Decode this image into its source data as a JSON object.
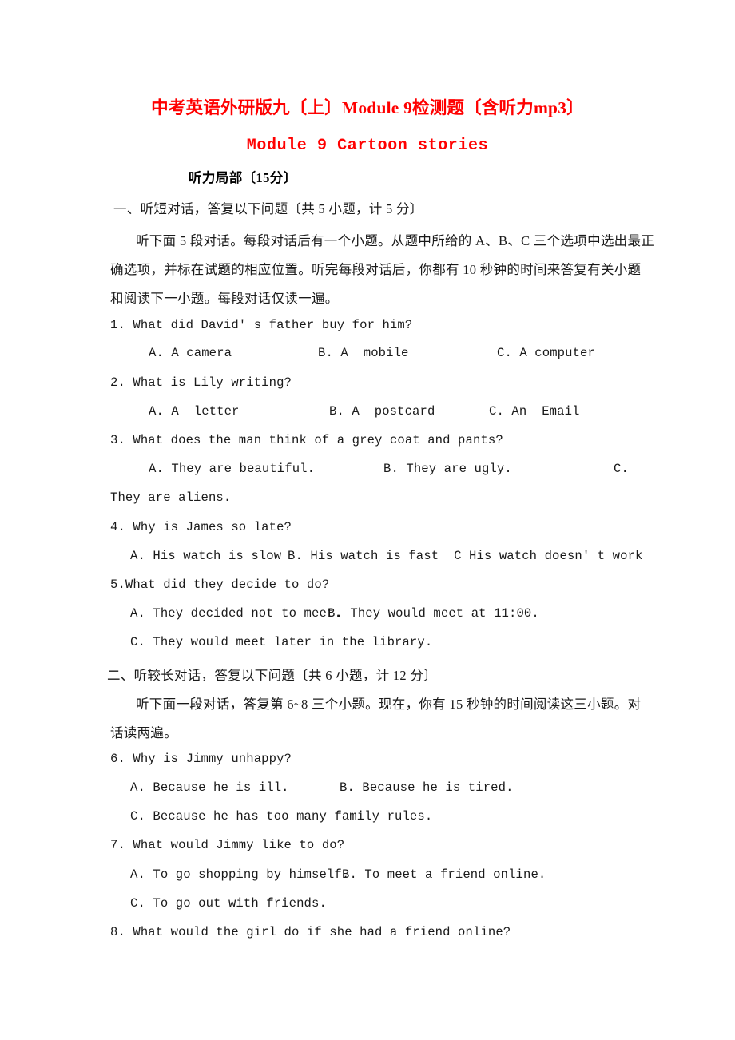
{
  "document": {
    "title": "中考英语外研版九〔上〕Module 9检测题〔含听力mp3〕",
    "subtitle": "Module 9  Cartoon stories",
    "section_heading": "听力局部〔15分〕",
    "title_color": "#ff0000"
  },
  "part_one": {
    "heading": "一、听短对话，答复以下问题〔共 5 小题，计 5 分〕",
    "instruction_lines": [
      "听下面 5 段对话。每段对话后有一个小题。从题中所给的 A、B、C 三个选项中选出最正",
      "确选项，并标在试题的相应位置。听完每段对话后，你都有 10 秒钟的时间来答复有关小题",
      "和阅读下一小题。每段对话仅读一遍。"
    ],
    "questions": [
      {
        "number": "1.",
        "stem": "1. What did David' s father buy for him?",
        "option_a": "A. A camera",
        "option_b": "B. A  mobile",
        "option_c": "C. A computer"
      },
      {
        "number": "2.",
        "stem": "2. What is Lily writing?",
        "option_a": "A. A  letter",
        "option_b": "B. A  postcard",
        "option_c": "C. An  Email"
      },
      {
        "number": "3.",
        "stem": "3. What does the man think of a grey coat and pants?",
        "option_a": "A. They are beautiful.",
        "option_b": "B. They are ugly.",
        "option_c": "C.",
        "option_c_wrap": "They are aliens."
      },
      {
        "number": "4.",
        "stem": "4. Why is James so late?",
        "option_a": "A. His watch is slow",
        "option_bc": "B. His watch is fast  C His watch doesn' t work"
      },
      {
        "number": "5.",
        "stem": "5.What did they decide to do?",
        "option_a": "A. They decided not to meet.",
        "option_b": "B. They would meet at 11:00.",
        "option_c": "C. They would meet later in the library."
      }
    ]
  },
  "part_two": {
    "heading": "二、听较长对话，答复以下问题〔共 6 小题，计 12 分〕",
    "instruction_lines": [
      "听下面一段对话，答复第 6~8 三个小题。现在，你有 15 秒钟的时间阅读这三小题。对",
      "话读两遍。"
    ],
    "questions": [
      {
        "number": "6.",
        "stem": "6. Why is Jimmy unhappy?",
        "option_a": "A. Because he is ill.",
        "option_b": "B. Because he is tired.",
        "option_c": "C. Because he has too many family rules."
      },
      {
        "number": "7.",
        "stem": "7. What would Jimmy like to do?",
        "option_a": "A. To go shopping by himself.",
        "option_b": "B. To meet a friend online.",
        "option_c": "C. To go out with friends."
      },
      {
        "number": "8.",
        "stem": "8. What would the girl do if she had a friend online?"
      }
    ]
  }
}
